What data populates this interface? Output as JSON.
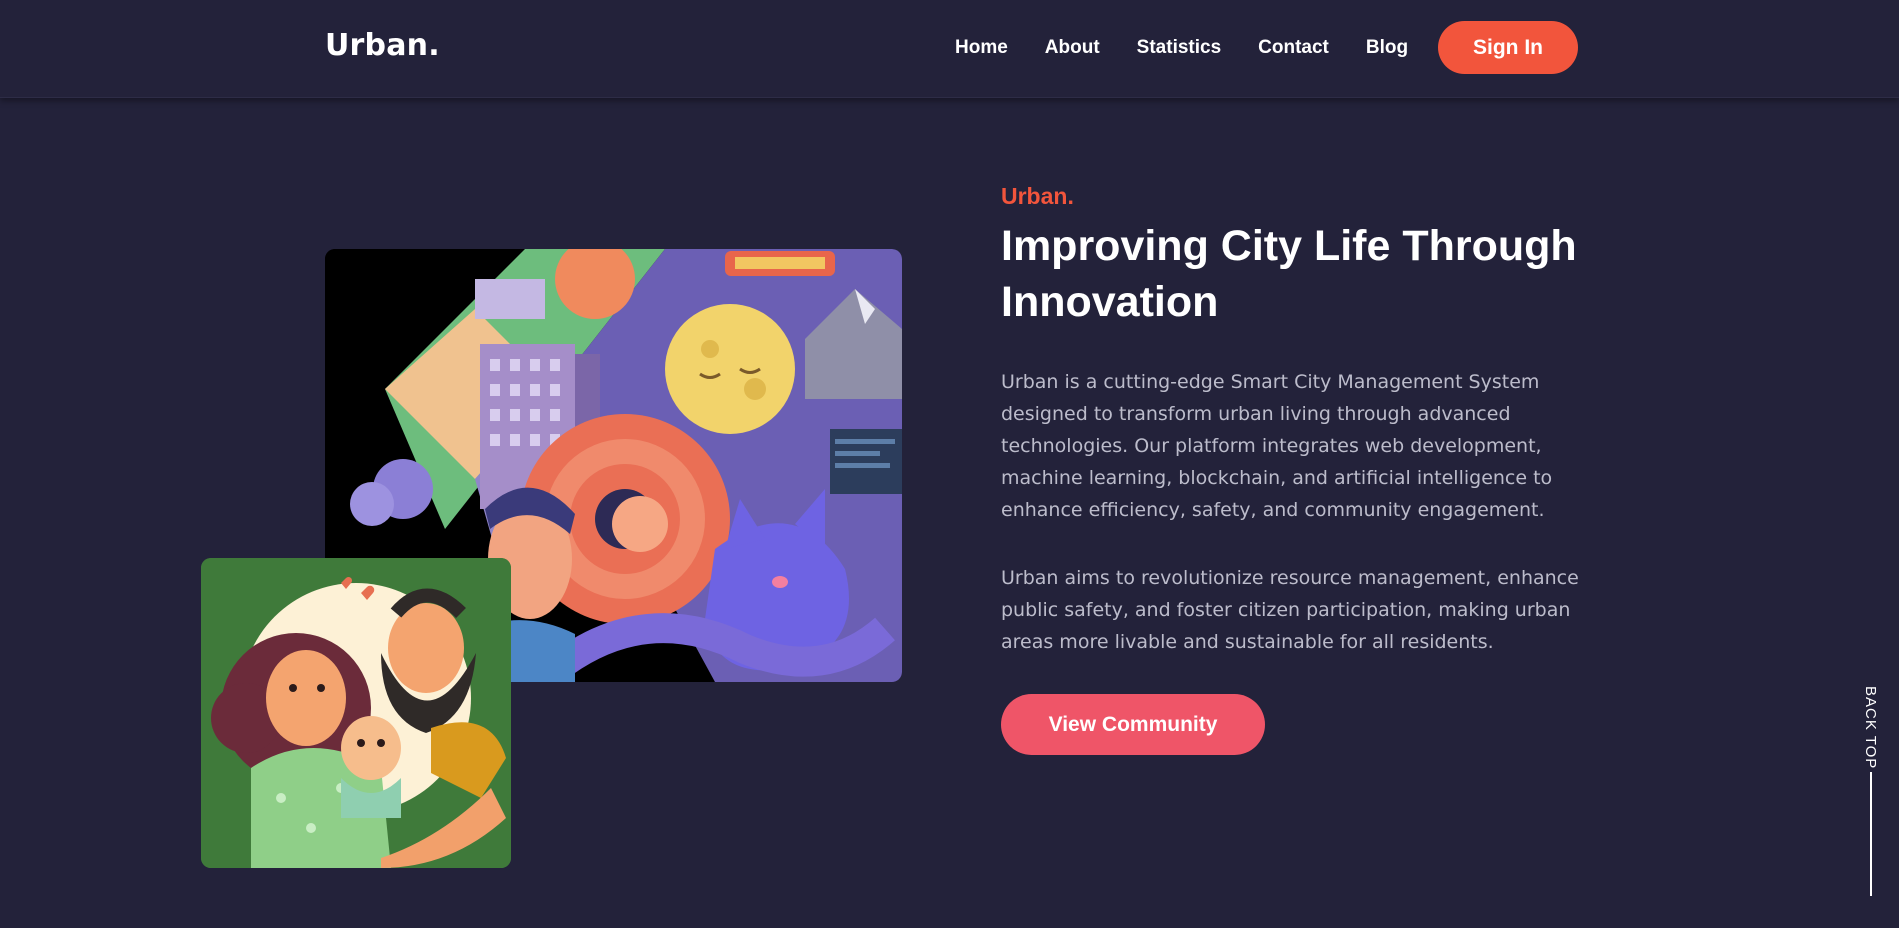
{
  "header": {
    "logo": "Urban.",
    "nav": [
      "Home",
      "About",
      "Statistics",
      "Contact",
      "Blog"
    ],
    "signin_label": "Sign In"
  },
  "hero": {
    "eyebrow": "Urban.",
    "title": "Improving City Life Through Innovation",
    "paragraphs": [
      "Urban is a cutting-edge Smart City Management System designed to transform urban living through advanced technologies. Our platform integrates web development, machine learning, blockchain, and artificial intelligence to enhance efficiency, safety, and community engagement.",
      "Urban aims to revolutionize resource management, enhance public safety, and foster citizen participation, making urban areas more livable and sustainable for all residents."
    ],
    "cta_label": "View Community"
  },
  "back_top": {
    "label": "BACK TOP"
  },
  "colors": {
    "background": "#23223a",
    "accent": "#f2553c",
    "cta": "#ef5568",
    "text_muted": "#bcbccb"
  },
  "icons": {
    "illustration_main": "city-life-illustration",
    "illustration_secondary": "family-illustration"
  }
}
